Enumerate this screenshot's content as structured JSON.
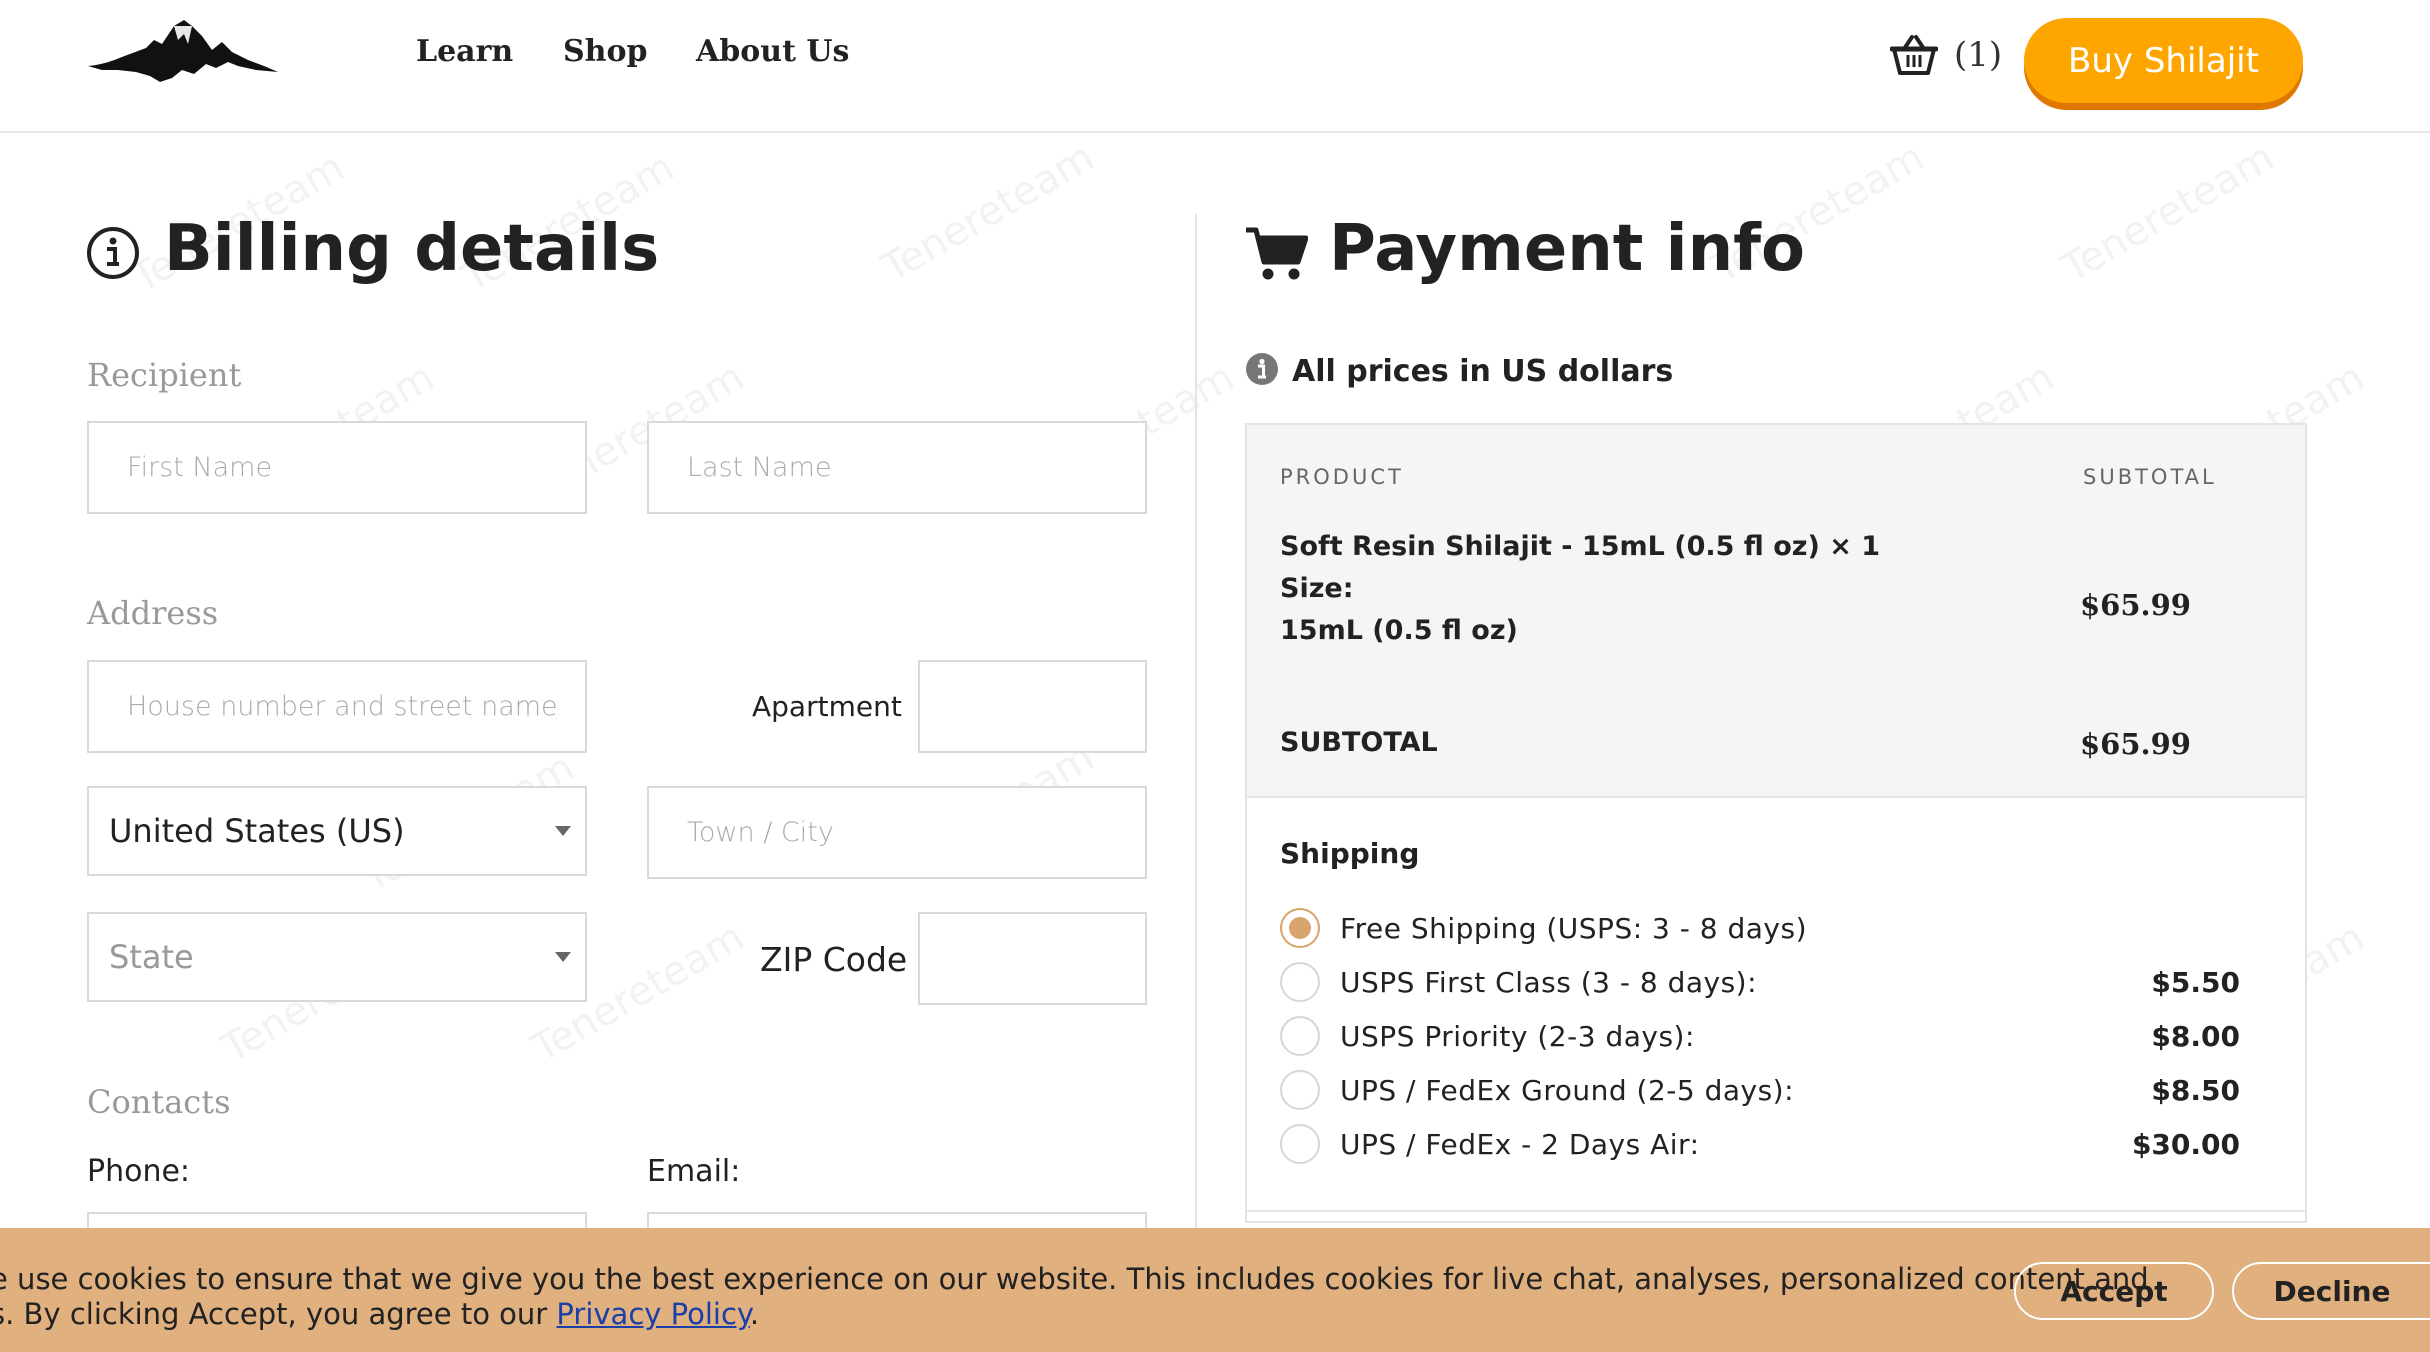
{
  "header": {
    "nav": [
      "Learn",
      "Shop",
      "About Us"
    ],
    "cart_count": "(1)",
    "buy_button": "Buy Shilajit"
  },
  "billing": {
    "title": "Billing details",
    "recipient_label": "Recipient",
    "first_name_placeholder": "First Name",
    "last_name_placeholder": "Last Name",
    "address_label": "Address",
    "street_placeholder": "House number and street name",
    "apartment_label": "Apartment",
    "country_value": "United States (US)",
    "city_placeholder": "Town / City",
    "state_placeholder": "State",
    "zip_label": "ZIP Code",
    "contacts_label": "Contacts",
    "phone_label": "Phone:",
    "email_label": "Email:"
  },
  "payment": {
    "title": "Payment info",
    "currency_note": "All prices in US dollars",
    "col_product": "PRODUCT",
    "col_subtotal": "SUBTOTAL",
    "item": {
      "name": "Soft Resin Shilajit - 15mL (0.5 fl oz)  × 1",
      "size_label": "Size:",
      "size_value": "15mL (0.5 fl oz)",
      "price": "$65.99"
    },
    "subtotal_label": "SUBTOTAL",
    "subtotal_value": "$65.99",
    "shipping_title": "Shipping",
    "shipping_options": [
      {
        "label": "Free Shipping (USPS: 3 - 8 days)",
        "price": "",
        "selected": true
      },
      {
        "label": "USPS First Class (3 - 8 days):",
        "price": "$5.50",
        "selected": false
      },
      {
        "label": "USPS Priority (2-3 days):",
        "price": "$8.00",
        "selected": false
      },
      {
        "label": "UPS / FedEx Ground (2-5 days):",
        "price": "$8.50",
        "selected": false
      },
      {
        "label": "UPS / FedEx - 2 Days Air:",
        "price": "$30.00",
        "selected": false
      }
    ]
  },
  "cookie": {
    "line1": "e use cookies to ensure that we give you the best experience on our website. This includes cookies for live chat, analyses, personalized content and",
    "line2_prefix": "s. By clicking Accept, you agree to our ",
    "policy_link": "Privacy Policy",
    "line2_suffix": ".",
    "accept": "Accept",
    "decline": "Decline"
  },
  "watermark": "Tenereteam",
  "colors": {
    "buy_button": "#ffa500",
    "cookie_bar": "#e0b07f",
    "radio_selected": "#d9a36e",
    "link": "#1a3fa6"
  }
}
